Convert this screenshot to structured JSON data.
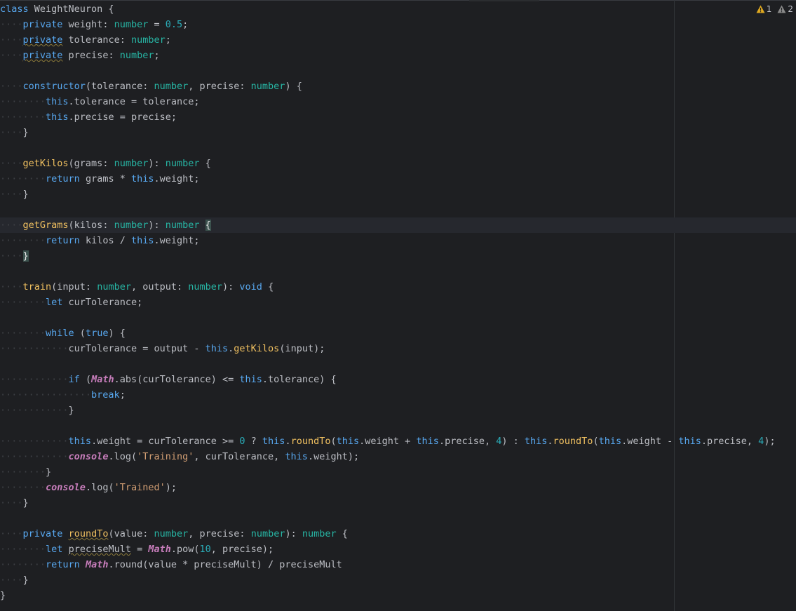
{
  "editor": {
    "status": {
      "warnings": [
        {
          "icon": "warning-triangle-icon",
          "count": "1",
          "color": "#e0a920"
        },
        {
          "icon": "weak-warning-triangle-icon",
          "count": "2",
          "color": "#8a8a8a"
        }
      ]
    },
    "code_lines": [
      "class WeightNeuron {",
      "    private weight: number = 0.5;",
      "    private tolerance: number;",
      "    private precise: number;",
      "",
      "    constructor(tolerance: number, precise: number) {",
      "        this.tolerance = tolerance;",
      "        this.precise = precise;",
      "    }",
      "",
      "    getKilos(grams: number): number {",
      "        return grams * this.weight;",
      "    }",
      "",
      "    getGrams(kilos: number): number {",
      "        return kilos / this.weight;",
      "    }",
      "",
      "    train(input: number, output: number): void {",
      "        let curTolerance;",
      "",
      "        while (true) {",
      "            curTolerance = output - this.getKilos(input);",
      "",
      "            if (Math.abs(curTolerance) <= this.tolerance) {",
      "                break;",
      "            }",
      "",
      "            this.weight = curTolerance >= 0 ? this.roundTo(this.weight + this.precise, 4) : this.roundTo(this.weight - this.precise, 4);",
      "            console.log('Training', curTolerance, this.weight);",
      "        }",
      "        console.log('Trained');",
      "    }",
      "",
      "    private roundTo(value: number, precise: number): number {",
      "        let preciseMult = Math.pow(10, precise);",
      "        return Math.round(value * preciseMult) / preciseMult",
      "    }",
      "}"
    ]
  },
  "colors": {
    "background": "#1e1f22",
    "keyword": "#58a8f0",
    "type": "#27b5a4",
    "function": "#f0c060",
    "number": "#2aacb8",
    "string": "#d39f74",
    "global": "#c77dbb",
    "text": "#bcbec4"
  }
}
